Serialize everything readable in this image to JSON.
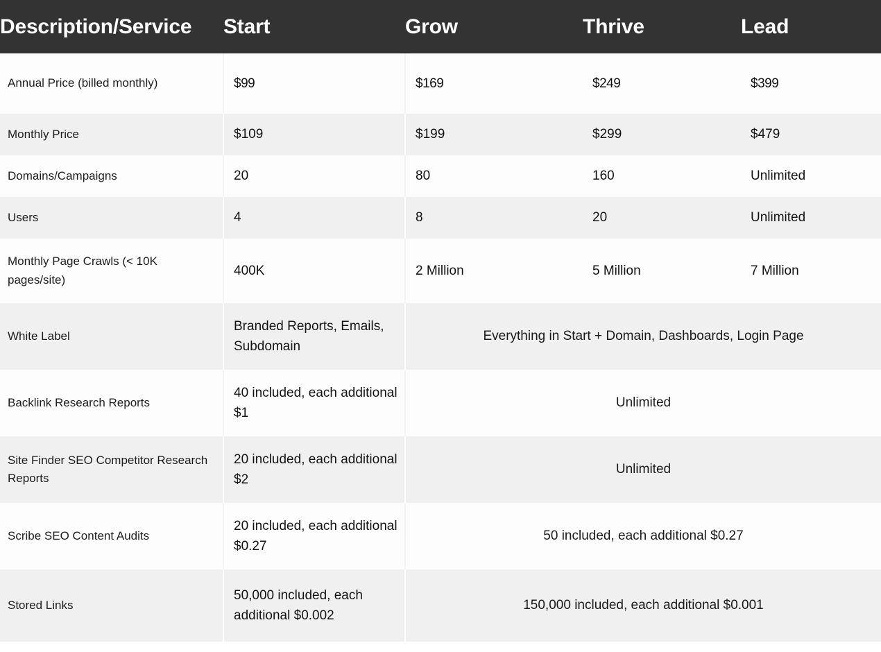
{
  "table": {
    "header": {
      "description_label": "Description/Service",
      "plans": [
        "Start",
        "Grow",
        "Thrive",
        "Lead"
      ]
    },
    "colors": {
      "header_bg": "#333333",
      "header_text": "#ffffff",
      "row_alt_bg": "#f0f0f0",
      "row_bg": "#ffffff",
      "body_text": "#1a1a1a"
    },
    "rows": [
      {
        "label": "Annual Price (billed monthly)",
        "type": "split",
        "values": [
          "$99",
          "$169",
          "$249",
          "$399"
        ],
        "emphasis": "large"
      },
      {
        "label": "Monthly Price",
        "type": "split",
        "values": [
          "$109",
          "$199",
          "$299",
          "$479"
        ]
      },
      {
        "label": "Domains/Campaigns",
        "type": "split",
        "values": [
          "20",
          "80",
          "160",
          "Unlimited"
        ]
      },
      {
        "label": "Users",
        "type": "split",
        "values": [
          "4",
          "8",
          "20",
          "Unlimited"
        ]
      },
      {
        "label": "Monthly Page Crawls (< 10K pages/site)",
        "type": "split",
        "values": [
          "400K",
          "2 Million",
          "5 Million",
          "7 Million"
        ]
      },
      {
        "label": "White Label",
        "type": "merged",
        "start_value": "Branded Reports, Emails, Subdomain",
        "merged_value": "Everything in Start + Domain, Dashboards, Login Page"
      },
      {
        "label": "Backlink Research Reports",
        "type": "merged",
        "start_value": "40 included, each additional $1",
        "merged_value": "Unlimited"
      },
      {
        "label": "Site Finder SEO Competitor Research Reports",
        "type": "merged",
        "start_value": "20 included, each additional $2",
        "merged_value": "Unlimited"
      },
      {
        "label": "Scribe SEO Content Audits",
        "type": "merged",
        "start_value": "20 included, each additional $0.27",
        "merged_value": "50 included, each additional $0.27"
      },
      {
        "label": "Stored Links",
        "type": "merged",
        "start_value": "50,000 included, each additional $0.002",
        "merged_value": "150,000 included, each additional $0.001"
      }
    ]
  }
}
